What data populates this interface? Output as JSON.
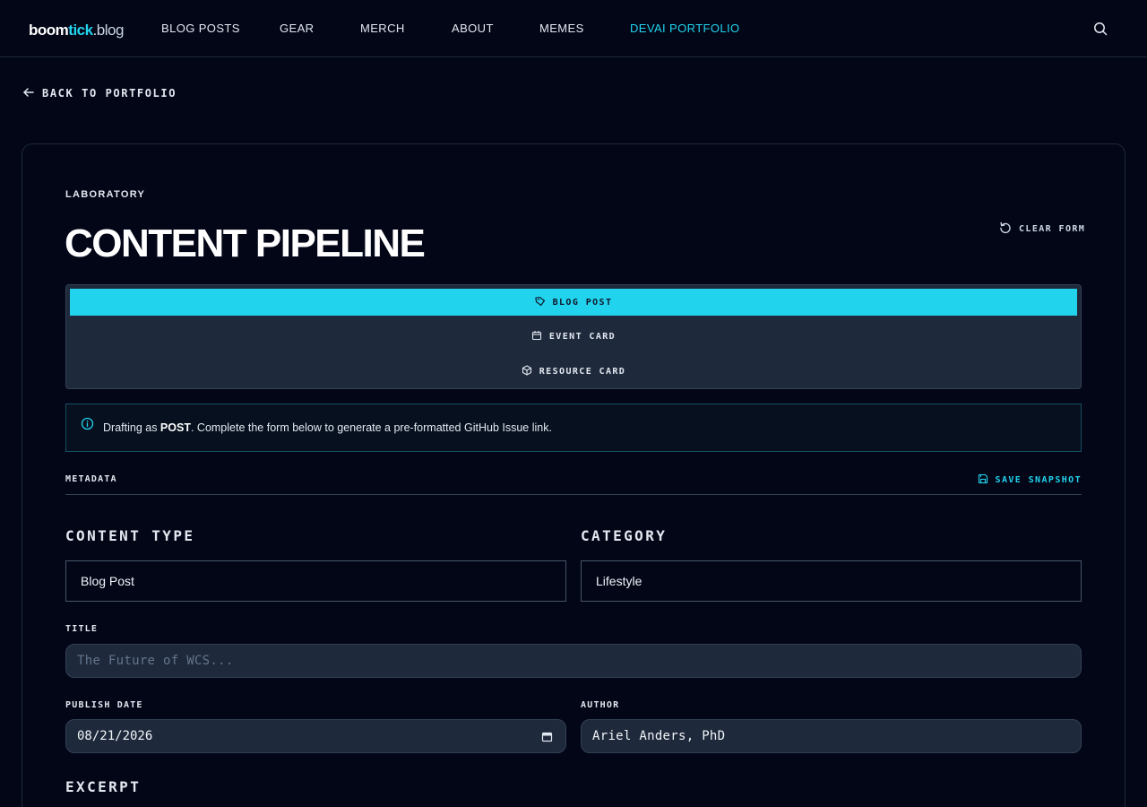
{
  "header": {
    "logo": {
      "part1": "boom",
      "part2": "tick",
      "part3": ".blog"
    },
    "nav": [
      {
        "label": "BLOG POSTS"
      },
      {
        "label": "GEAR"
      },
      {
        "label": "MERCH"
      },
      {
        "label": "ABOUT"
      },
      {
        "label": "MEMES"
      },
      {
        "label": "DEVAI PORTFOLIO",
        "active": true
      }
    ],
    "search_icon": "search-icon"
  },
  "back_link": {
    "label": "BACK TO PORTFOLIO"
  },
  "page": {
    "eyebrow": "LABORATORY",
    "title": "CONTENT PIPELINE",
    "clear_label": "CLEAR FORM"
  },
  "type_selector": {
    "options": [
      {
        "label": "BLOG POST",
        "icon": "tag-icon",
        "active": true
      },
      {
        "label": "EVENT CARD",
        "icon": "calendar-icon"
      },
      {
        "label": "RESOURCE CARD",
        "icon": "box-icon"
      }
    ]
  },
  "info": {
    "prefix": "Drafting as ",
    "type": "POST",
    "suffix": ". Complete the form below to generate a pre-formatted GitHub Issue link."
  },
  "metadata": {
    "label": "METADATA",
    "save_label": "SAVE SNAPSHOT"
  },
  "form": {
    "content_type": {
      "label": "CONTENT TYPE",
      "value": "Blog Post"
    },
    "category": {
      "label": "CATEGORY",
      "value": "Lifestyle"
    },
    "title": {
      "label": "TITLE",
      "placeholder": "The Future of WCS..."
    },
    "publish_date": {
      "label": "PUBLISH DATE",
      "value": "08/21/2026"
    },
    "author": {
      "label": "AUTHOR",
      "value": "Ariel Anders, PhD"
    },
    "excerpt": {
      "label": "EXCERPT"
    }
  },
  "colors": {
    "accent": "#22d3ee",
    "background": "#020617",
    "panel": "#1e293b"
  }
}
